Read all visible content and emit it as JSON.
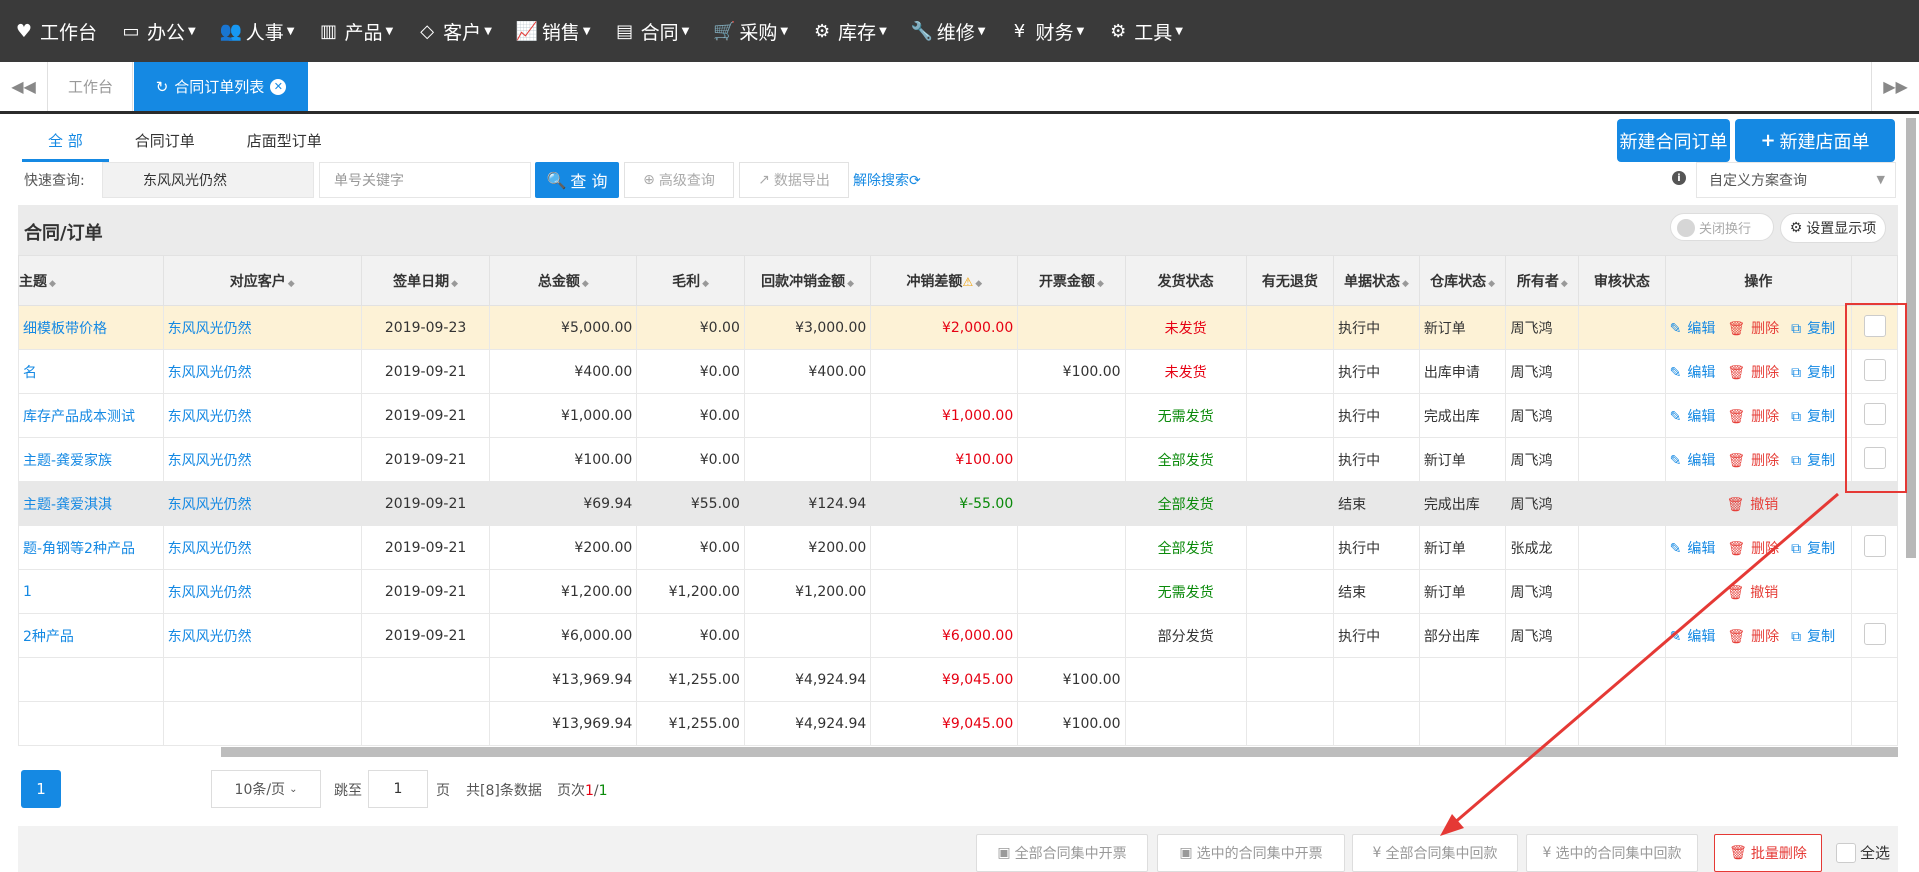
{
  "nav": [
    {
      "icon": "♥",
      "icon_name": "heart-icon",
      "label": "工作台",
      "caret": false
    },
    {
      "icon": "▭",
      "icon_name": "laptop-icon",
      "label": "办公",
      "caret": true
    },
    {
      "icon": "👥",
      "icon_name": "users-icon",
      "label": "人事",
      "caret": true
    },
    {
      "icon": "▥",
      "icon_name": "barcode-icon",
      "label": "产品",
      "caret": true
    },
    {
      "icon": "◇",
      "icon_name": "diamond-icon",
      "label": "客户",
      "caret": true
    },
    {
      "icon": "📈",
      "icon_name": "line-chart-icon",
      "label": "销售",
      "caret": true
    },
    {
      "icon": "▤",
      "icon_name": "contract-icon",
      "label": "合同",
      "caret": true
    },
    {
      "icon": "🛒",
      "icon_name": "cart-icon",
      "label": "采购",
      "caret": true
    },
    {
      "icon": "⚙",
      "icon_name": "cogs-icon",
      "label": "库存",
      "caret": true
    },
    {
      "icon": "🔧",
      "icon_name": "wrench-icon",
      "label": "维修",
      "caret": true
    },
    {
      "icon": "¥",
      "icon_name": "yen-icon",
      "label": "财务",
      "caret": true
    },
    {
      "icon": "⚙",
      "icon_name": "gear-icon",
      "label": "工具",
      "caret": true
    }
  ],
  "tabs": {
    "workbench": "工作台",
    "active": "合同订单列表"
  },
  "subtabs": [
    "全 部",
    "合同订单",
    "店面型订单"
  ],
  "buttons": {
    "new_contract": "新建合同订单",
    "new_store": "新建店面单"
  },
  "search": {
    "label": "快速查询:",
    "customer_value": "东风风光仍然",
    "keyword_placeholder": "单号关键字",
    "query": "查 询",
    "advanced": "高级查询",
    "export": "数据导出",
    "reset": "解除搜索",
    "scheme_placeholder": "自定义方案查询"
  },
  "panel": {
    "title": "合同/订单",
    "toggle_label": "关闭换行",
    "set_columns": "设置显示项"
  },
  "columns": [
    "主题",
    "对应客户",
    "签单日期",
    "总金额",
    "毛利",
    "回款冲销金额",
    "冲销差额",
    "开票金额",
    "发货状态",
    "有无退货",
    "单据状态",
    "仓库状态",
    "所有者",
    "审核状态",
    "操作"
  ],
  "ops": {
    "edit": "编辑",
    "delete": "删除",
    "copy": "复制",
    "revoke": "撤销"
  },
  "rows": [
    {
      "subject": "细模板带价格",
      "customer": "东风风光仍然",
      "date": "2019-09-23",
      "total": "¥5,000.00",
      "profit": "¥0.00",
      "writeoff": "¥3,000.00",
      "diff": "¥2,000.00",
      "diff_color": "red",
      "invoice": "",
      "ship": "未发货",
      "ship_color": "red",
      "ret": "",
      "doc": "执行中",
      "wh": "新订单",
      "owner": "周飞鸿",
      "audit": "",
      "mode": "edit",
      "style": "hl"
    },
    {
      "subject": "名",
      "customer": "东风风光仍然",
      "date": "2019-09-21",
      "total": "¥400.00",
      "profit": "¥0.00",
      "writeoff": "¥400.00",
      "diff": "",
      "diff_color": "",
      "invoice": "¥100.00",
      "ship": "未发货",
      "ship_color": "red",
      "ret": "",
      "doc": "执行中",
      "wh": "出库申请",
      "owner": "周飞鸿",
      "audit": "",
      "mode": "edit",
      "style": ""
    },
    {
      "subject": "库存产品成本测试",
      "customer": "东风风光仍然",
      "date": "2019-09-21",
      "total": "¥1,000.00",
      "profit": "¥0.00",
      "writeoff": "",
      "diff": "¥1,000.00",
      "diff_color": "red",
      "invoice": "",
      "ship": "无需发货",
      "ship_color": "green",
      "ret": "",
      "doc": "执行中",
      "wh": "完成出库",
      "owner": "周飞鸿",
      "audit": "",
      "mode": "edit",
      "style": ""
    },
    {
      "subject": "主题-龚爱家族",
      "customer": "东风风光仍然",
      "date": "2019-09-21",
      "total": "¥100.00",
      "profit": "¥0.00",
      "writeoff": "",
      "diff": "¥100.00",
      "diff_color": "red",
      "invoice": "",
      "ship": "全部发货",
      "ship_color": "green",
      "ret": "",
      "doc": "执行中",
      "wh": "新订单",
      "owner": "周飞鸿",
      "audit": "",
      "mode": "edit",
      "style": ""
    },
    {
      "subject": "主题-龚爱淇淇",
      "customer": "东风风光仍然",
      "date": "2019-09-21",
      "total": "¥69.94",
      "profit": "¥55.00",
      "writeoff": "¥124.94",
      "diff": "¥-55.00",
      "diff_color": "green",
      "invoice": "",
      "ship": "全部发货",
      "ship_color": "green",
      "ret": "",
      "doc": "结束",
      "wh": "完成出库",
      "owner": "周飞鸿",
      "audit": "",
      "mode": "revoke",
      "style": "gray"
    },
    {
      "subject": "题-角钢等2种产品",
      "customer": "东风风光仍然",
      "date": "2019-09-21",
      "total": "¥200.00",
      "profit": "¥0.00",
      "writeoff": "¥200.00",
      "diff": "",
      "diff_color": "",
      "invoice": "",
      "ship": "全部发货",
      "ship_color": "green",
      "ret": "",
      "doc": "执行中",
      "wh": "新订单",
      "owner": "张成龙",
      "audit": "",
      "mode": "edit",
      "style": ""
    },
    {
      "subject": "1",
      "customer": "东风风光仍然",
      "date": "2019-09-21",
      "total": "¥1,200.00",
      "profit": "¥1,200.00",
      "writeoff": "¥1,200.00",
      "diff": "",
      "diff_color": "",
      "invoice": "",
      "ship": "无需发货",
      "ship_color": "green",
      "ret": "",
      "doc": "结束",
      "wh": "新订单",
      "owner": "周飞鸿",
      "audit": "",
      "mode": "revoke",
      "style": ""
    },
    {
      "subject": "2种产品",
      "customer": "东风风光仍然",
      "date": "2019-09-21",
      "total": "¥6,000.00",
      "profit": "¥0.00",
      "writeoff": "",
      "diff": "¥6,000.00",
      "diff_color": "red",
      "invoice": "",
      "ship": "部分发货",
      "ship_color": "plain",
      "ret": "",
      "doc": "执行中",
      "wh": "部分出库",
      "owner": "周飞鸿",
      "audit": "",
      "mode": "edit",
      "style": ""
    }
  ],
  "totals": [
    {
      "total": "¥13,969.94",
      "profit": "¥1,255.00",
      "writeoff": "¥4,924.94",
      "diff": "¥9,045.00",
      "invoice": "¥100.00"
    },
    {
      "total": "¥13,969.94",
      "profit": "¥1,255.00",
      "writeoff": "¥4,924.94",
      "diff": "¥9,045.00",
      "invoice": "¥100.00"
    }
  ],
  "pager": {
    "current": "1",
    "per_page": "10条/页",
    "jump_to": "跳至",
    "jump_value": "1",
    "page_unit": "页",
    "total_text": "共[8]条数据",
    "page_text": "页次",
    "page_current": "1",
    "page_sep": "/",
    "page_total": "1"
  },
  "bottom": {
    "all_invoice": "全部合同集中开票",
    "sel_invoice": "选中的合同集中开票",
    "all_payment": "全部合同集中回款",
    "sel_payment": "选中的合同集中回款",
    "batch_delete": "批量删除",
    "select_all": "全选"
  },
  "colors": {
    "accent": "#1589e3",
    "danger": "#e60012",
    "success": "#0a8a0a",
    "nav_bg": "#3a3a3a",
    "annotation": "#e53935"
  }
}
